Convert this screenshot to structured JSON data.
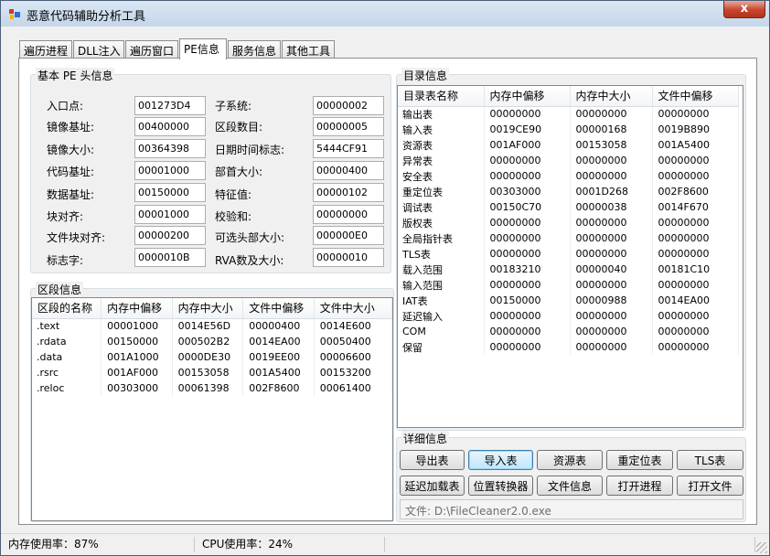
{
  "window": {
    "title": "恶意代码辅助分析工具",
    "close_glyph": "x"
  },
  "tabs": [
    "遍历进程",
    "DLL注入",
    "遍历窗口",
    "PE信息",
    "服务信息",
    "其他工具"
  ],
  "pe_header": {
    "group_title": "基本 PE 头信息",
    "left": [
      {
        "label": "入口点:",
        "value": "001273D4"
      },
      {
        "label": "镜像基址:",
        "value": "00400000"
      },
      {
        "label": "镜像大小:",
        "value": "00364398"
      },
      {
        "label": "代码基址:",
        "value": "00001000"
      },
      {
        "label": "数据基址:",
        "value": "00150000"
      },
      {
        "label": "块对齐:",
        "value": "00001000"
      },
      {
        "label": "文件块对齐:",
        "value": "00000200"
      },
      {
        "label": "标志字:",
        "value": "0000010B"
      }
    ],
    "right": [
      {
        "label": "子系统:",
        "value": "00000002"
      },
      {
        "label": "区段数目:",
        "value": "00000005"
      },
      {
        "label": "日期时间标志:",
        "value": "5444CF91"
      },
      {
        "label": "部首大小:",
        "value": "00000400"
      },
      {
        "label": "特征值:",
        "value": "00000102"
      },
      {
        "label": "校验和:",
        "value": "00000000"
      },
      {
        "label": "可选头部大小:",
        "value": "000000E0"
      },
      {
        "label": "RVA数及大小:",
        "value": "00000010"
      }
    ]
  },
  "sections": {
    "group_title": "区段信息",
    "columns": [
      "区段的名称",
      "内存中偏移",
      "内存中大小",
      "文件中偏移",
      "文件中大小"
    ],
    "rows": [
      [
        ".text",
        "00001000",
        "0014E56D",
        "00000400",
        "0014E600"
      ],
      [
        ".rdata",
        "00150000",
        "000502B2",
        "0014EA00",
        "00050400"
      ],
      [
        ".data",
        "001A1000",
        "0000DE30",
        "0019EE00",
        "00006600"
      ],
      [
        ".rsrc",
        "001AF000",
        "00153058",
        "001A5400",
        "00153200"
      ],
      [
        ".reloc",
        "00303000",
        "00061398",
        "002F8600",
        "00061400"
      ]
    ]
  },
  "directory": {
    "group_title": "目录信息",
    "columns": [
      "目录表名称",
      "内存中偏移",
      "内存中大小",
      "文件中偏移"
    ],
    "rows": [
      [
        "输出表",
        "00000000",
        "00000000",
        "00000000"
      ],
      [
        "输入表",
        "0019CE90",
        "00000168",
        "0019B890"
      ],
      [
        "资源表",
        "001AF000",
        "00153058",
        "001A5400"
      ],
      [
        "异常表",
        "00000000",
        "00000000",
        "00000000"
      ],
      [
        "安全表",
        "00000000",
        "00000000",
        "00000000"
      ],
      [
        "重定位表",
        "00303000",
        "0001D268",
        "002F8600"
      ],
      [
        "调试表",
        "00150C70",
        "00000038",
        "0014F670"
      ],
      [
        "版权表",
        "00000000",
        "00000000",
        "00000000"
      ],
      [
        "全局指针表",
        "00000000",
        "00000000",
        "00000000"
      ],
      [
        "TLS表",
        "00000000",
        "00000000",
        "00000000"
      ],
      [
        "载入范围",
        "00183210",
        "00000040",
        "00181C10"
      ],
      [
        "输入范围",
        "00000000",
        "00000000",
        "00000000"
      ],
      [
        "IAT表",
        "00150000",
        "00000988",
        "0014EA00"
      ],
      [
        "延迟输入",
        "00000000",
        "00000000",
        "00000000"
      ],
      [
        "COM",
        "00000000",
        "00000000",
        "00000000"
      ],
      [
        "保留",
        "00000000",
        "00000000",
        "00000000"
      ]
    ]
  },
  "details": {
    "group_title": "详细信息",
    "row1": [
      "导出表",
      "导入表",
      "资源表",
      "重定位表",
      "TLS表"
    ],
    "row2": [
      "延迟加载表",
      "位置转换器",
      "文件信息",
      "打开进程",
      "打开文件"
    ],
    "file_path": "文件: D:\\FileCleaner2.0.exe"
  },
  "status": {
    "memory": "内存使用率：87%",
    "cpu": "CPU使用率：24%"
  }
}
